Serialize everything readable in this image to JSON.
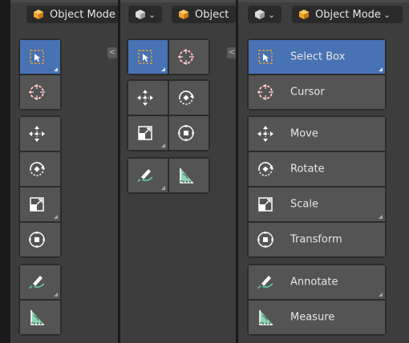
{
  "header": {
    "mode_label": "Object Mode",
    "mode_label_truncated": "Object"
  },
  "tools": [
    {
      "id": "select-box",
      "label": "Select Box",
      "icon": "select-box-icon",
      "active": true,
      "corner": true
    },
    {
      "id": "cursor",
      "label": "Cursor",
      "icon": "cursor-icon",
      "active": false,
      "corner": false
    },
    {
      "id": "move",
      "label": "Move",
      "icon": "move-icon",
      "active": false,
      "corner": false
    },
    {
      "id": "rotate",
      "label": "Rotate",
      "icon": "rotate-icon",
      "active": false,
      "corner": false
    },
    {
      "id": "scale",
      "label": "Scale",
      "icon": "scale-icon",
      "active": false,
      "corner": true
    },
    {
      "id": "transform",
      "label": "Transform",
      "icon": "transform-icon",
      "active": false,
      "corner": false
    },
    {
      "id": "annotate",
      "label": "Annotate",
      "icon": "annotate-icon",
      "active": false,
      "corner": true
    },
    {
      "id": "measure",
      "label": "Measure",
      "icon": "measure-icon",
      "active": false,
      "corner": false
    }
  ],
  "colors": {
    "background": "#3d3d3d",
    "tool_button": "#545454",
    "tool_active": "#4772b3",
    "mode_cube": "#f0a32a",
    "cursor_ring": "#e15a5a",
    "measure_fill": "#8fd3b5"
  }
}
